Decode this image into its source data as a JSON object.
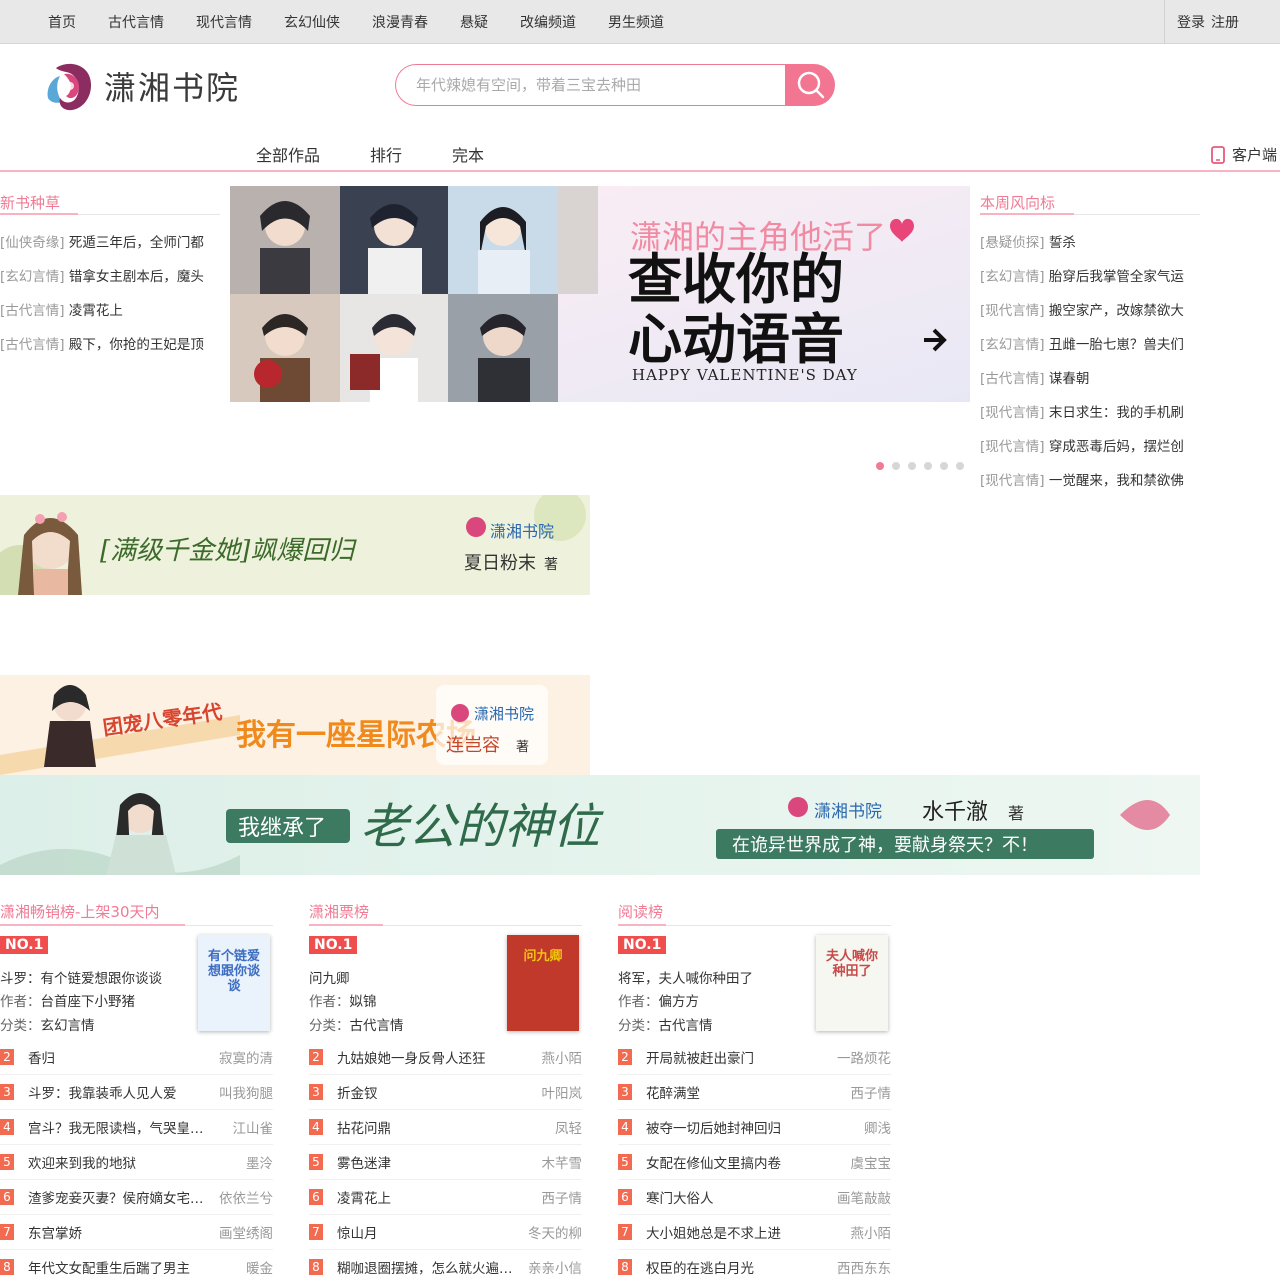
{
  "topbar": {
    "nav": [
      "首页",
      "古代言情",
      "现代言情",
      "玄幻仙侠",
      "浪漫青春",
      "悬疑",
      "改编频道",
      "男生频道"
    ],
    "login": "登录",
    "register": "注册"
  },
  "header": {
    "logo_text": "潇湘书院",
    "search_placeholder": "年代辣媳有空间，带着三宝去种田",
    "accent_color": "#f27592"
  },
  "mainnav": {
    "items": [
      "全部作品",
      "排行",
      "完本"
    ],
    "client": "客户端"
  },
  "new_books": {
    "title": "新书种草",
    "rows": [
      {
        "tag": "[仙侠奇缘]",
        "name": "死遁三年后，全师门都"
      },
      {
        "tag": "[玄幻言情]",
        "name": "错拿女主剧本后，魔头"
      },
      {
        "tag": "[古代言情]",
        "name": "凌霄花上"
      },
      {
        "tag": "[古代言情]",
        "name": "殿下，你抢的王妃是顶"
      }
    ]
  },
  "banner": {
    "headline_top": "潇湘的主角他活了",
    "headline_line1": "查收你的",
    "headline_line2": "心动语音",
    "subline": "HAPPY VALENTINE'S DAY",
    "dots": 6,
    "active_dot": 0
  },
  "weekly": {
    "title": "本周风向标",
    "rows": [
      {
        "tag": "[悬疑侦探]",
        "name": "誓杀"
      },
      {
        "tag": "[玄幻言情]",
        "name": "胎穿后我掌管全家气运"
      },
      {
        "tag": "[现代言情]",
        "name": "搬空家产，改嫁禁欲大"
      },
      {
        "tag": "[玄幻言情]",
        "name": "丑雌一胎七崽？兽夫们"
      },
      {
        "tag": "[古代言情]",
        "name": "谋春朝"
      },
      {
        "tag": "[现代言情]",
        "name": "末日求生：我的手机刷"
      },
      {
        "tag": "[现代言情]",
        "name": "穿成恶毒后妈，摆烂创"
      },
      {
        "tag": "[现代言情]",
        "name": "一觉醒来，我和禁欲佛"
      }
    ]
  },
  "ads": [
    {
      "title": "[满级千金她]飒爆回归",
      "brand": "潇湘书院",
      "author": "夏日粉末",
      "suffix": "著"
    },
    {
      "title_a": "团宠八零年代",
      "title_b": "我有一座星际农场",
      "brand": "潇湘书院",
      "author": "连岂容",
      "suffix": "著"
    },
    {
      "title_a": "我继承了",
      "title_b": "老公的神位",
      "brand": "潇湘书院",
      "author": "水千澈",
      "suffix": "著",
      "tagline": "在诡异世界成了神，要献身祭天？不！"
    }
  ],
  "rankings": [
    {
      "title": "潇湘畅销榜-上架30天内",
      "no1_label": "NO.1",
      "top": {
        "name": "斗罗：有个链爱想跟你谈谈",
        "author_label": "作者：",
        "author": "台首座下小野猪",
        "cat_label": "分类：",
        "category": "玄幻言情",
        "cover_text": "有个链爱想跟你谈谈"
      },
      "rows": [
        {
          "num": "2",
          "name": "香归",
          "author": "寂寞的清"
        },
        {
          "num": "3",
          "name": "斗罗：我靠装乖人见人爱",
          "author": "叫我狗腿"
        },
        {
          "num": "4",
          "name": "宫斗？我无限读档，气哭皇…",
          "author": "江山雀"
        },
        {
          "num": "5",
          "name": "欢迎来到我的地狱",
          "author": "墨泠"
        },
        {
          "num": "6",
          "name": "渣爹宠妾灭妻？侯府嫡女宅…",
          "author": "依依兰兮"
        },
        {
          "num": "7",
          "name": "东宫掌娇",
          "author": "画堂绣阁"
        },
        {
          "num": "8",
          "name": "年代文女配重生后踹了男主",
          "author": "暖金"
        }
      ]
    },
    {
      "title": "潇湘票榜",
      "no1_label": "NO.1",
      "top": {
        "name": "问九卿",
        "author_label": "作者：",
        "author": "姒锦",
        "cat_label": "分类：",
        "category": "古代言情",
        "cover_text": "问九卿"
      },
      "rows": [
        {
          "num": "2",
          "name": "九姑娘她一身反骨人还狂",
          "author": "燕小陌"
        },
        {
          "num": "3",
          "name": "折金钗",
          "author": "叶阳岚"
        },
        {
          "num": "4",
          "name": "拈花问鼎",
          "author": "凤轻"
        },
        {
          "num": "5",
          "name": "雾色迷津",
          "author": "木芊雪"
        },
        {
          "num": "6",
          "name": "凌霄花上",
          "author": "西子情"
        },
        {
          "num": "7",
          "name": "惊山月",
          "author": "冬天的柳"
        },
        {
          "num": "8",
          "name": "糊咖退圈摆摊，怎么就火遍…",
          "author": "亲亲小信"
        }
      ]
    },
    {
      "title": "阅读榜",
      "no1_label": "NO.1",
      "top": {
        "name": "将军，夫人喊你种田了",
        "author_label": "作者：",
        "author": "偏方方",
        "cat_label": "分类：",
        "category": "古代言情",
        "cover_text": "夫人喊你种田了"
      },
      "rows": [
        {
          "num": "2",
          "name": "开局就被赶出豪门",
          "author": "一路烦花"
        },
        {
          "num": "3",
          "name": "花醉满堂",
          "author": "西子情"
        },
        {
          "num": "4",
          "name": "被夺一切后她封神回归",
          "author": "卿浅"
        },
        {
          "num": "5",
          "name": "女配在修仙文里搞内卷",
          "author": "虞宝宝"
        },
        {
          "num": "6",
          "name": "寒门大俗人",
          "author": "画笔敲敲"
        },
        {
          "num": "7",
          "name": "大小姐她总是不求上进",
          "author": "燕小陌"
        },
        {
          "num": "8",
          "name": "权臣的在逃白月光",
          "author": "西西东东"
        }
      ]
    }
  ]
}
